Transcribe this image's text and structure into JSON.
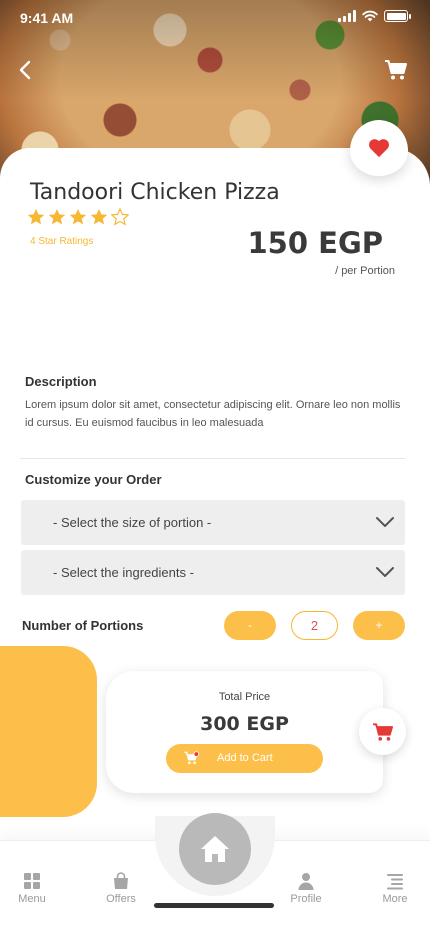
{
  "status_bar": {
    "time": "9:41 AM"
  },
  "product": {
    "name": "Tandoori Chicken Pizza",
    "rating": 4,
    "rating_max": 5,
    "rating_label": "4 Star Ratings",
    "price": "150 EGP",
    "price_unit": "/ per Portion",
    "is_favorite": true
  },
  "description": {
    "heading": "Description",
    "text": "Lorem ipsum dolor sit amet, consectetur adipiscing elit. Ornare leo non mollis id cursus. Eu euismod faucibus in leo malesuada"
  },
  "customize": {
    "heading": "Customize your Order",
    "size_select": "- Select the size of portion -",
    "ingredients_select": "- Select the ingredients -"
  },
  "portions": {
    "label": "Number of Portions",
    "decrement": "-",
    "count": "2",
    "increment": "+"
  },
  "total": {
    "label": "Total Price",
    "value": "300 EGP",
    "add_to_cart": "Add to Cart"
  },
  "nav": {
    "items": [
      {
        "label": "Menu",
        "icon": "grid-icon"
      },
      {
        "label": "Offers",
        "icon": "bag-icon"
      },
      {
        "label": "Profile",
        "icon": "user-icon"
      },
      {
        "label": "More",
        "icon": "list-icon"
      }
    ],
    "home_icon": "home-icon"
  },
  "colors": {
    "accent": "#fcc04a",
    "star": "#f7b733",
    "heart": "#e53935",
    "cart_red": "#e53935",
    "nav_inactive": "#9a9a9a"
  }
}
